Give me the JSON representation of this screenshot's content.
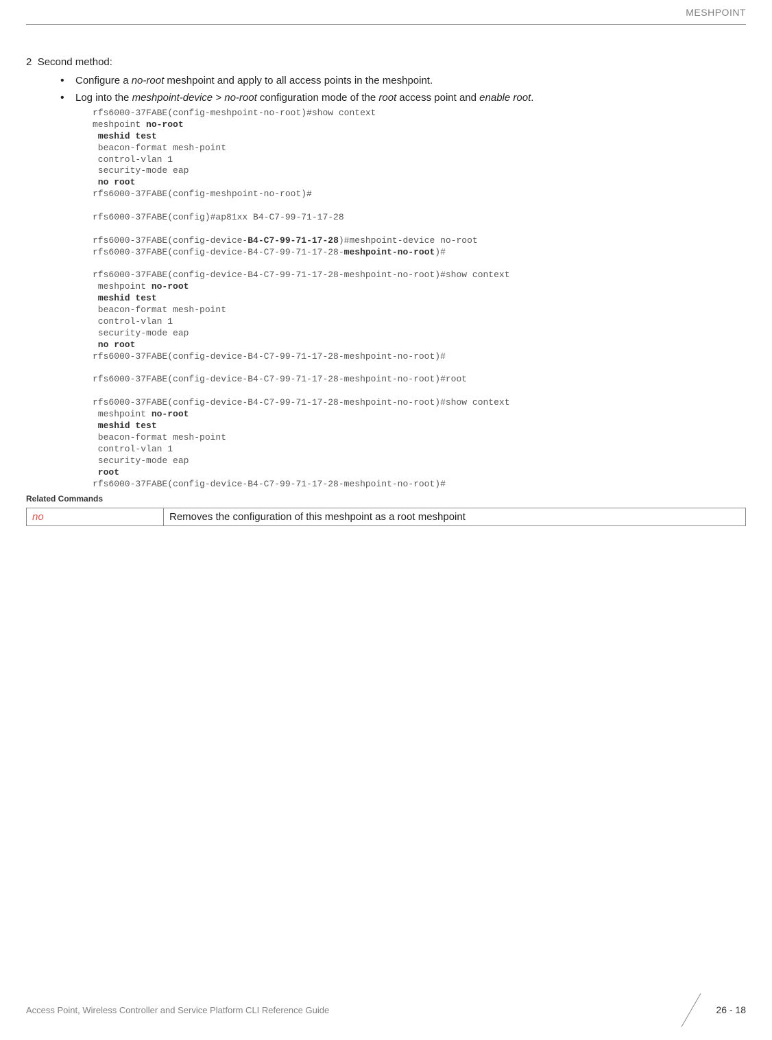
{
  "header": "MESHPOINT",
  "method": {
    "number": "2",
    "title": "Second method:",
    "bullets": [
      "Configure a <span class=\"italic\">no-root</span> meshpoint and apply to all access points in the meshpoint.",
      "Log into the <span class=\"italic\">meshpoint-device &gt; no-root</span> configuration mode of the <span class=\"italic\">root</span> access point and <span class=\"italic\">enable root</span>."
    ]
  },
  "code": {
    "l1": "rfs6000-37FABE(config-meshpoint-no-root)#show context",
    "l2a": "meshpoint ",
    "l2b": "no-root",
    "l3": " meshid test",
    "l4": " beacon-format mesh-point",
    "l5": " control-vlan 1",
    "l6": " security-mode eap",
    "l7": " no root",
    "l8": "rfs6000-37FABE(config-meshpoint-no-root)#",
    "l9": "",
    "l10": "rfs6000-37FABE(config)#ap81xx B4-C7-99-71-17-28",
    "l11": "",
    "l12a": "rfs6000-37FABE(config-device-",
    "l12b": "B4-C7-99-71-17-28",
    "l12c": ")#meshpoint-device no-root",
    "l13a": "rfs6000-37FABE(config-device-B4-C7-99-71-17-28-",
    "l13b": "meshpoint-no-root",
    "l13c": ")#",
    "l14": "",
    "l15": "rfs6000-37FABE(config-device-B4-C7-99-71-17-28-meshpoint-no-root)#show context",
    "l16a": " meshpoint ",
    "l16b": "no-root",
    "l17": " meshid test",
    "l18": " beacon-format mesh-point",
    "l19": " control-vlan 1",
    "l20": " security-mode eap",
    "l21": " no root",
    "l22": "rfs6000-37FABE(config-device-B4-C7-99-71-17-28-meshpoint-no-root)#",
    "l23": "",
    "l24": "rfs6000-37FABE(config-device-B4-C7-99-71-17-28-meshpoint-no-root)#root",
    "l25": "",
    "l26": "rfs6000-37FABE(config-device-B4-C7-99-71-17-28-meshpoint-no-root)#show context",
    "l27a": " meshpoint ",
    "l27b": "no-root",
    "l28": " meshid test",
    "l29": " beacon-format mesh-point",
    "l30": " control-vlan 1",
    "l31": " security-mode eap",
    "l32": " root",
    "l33": "rfs6000-37FABE(config-device-B4-C7-99-71-17-28-meshpoint-no-root)#"
  },
  "relatedCommands": {
    "title": "Related Commands",
    "rows": [
      {
        "cmd": "no",
        "desc": "Removes the configuration of this meshpoint as a root meshpoint"
      }
    ]
  },
  "footer": {
    "text": "Access Point, Wireless Controller and Service Platform CLI Reference Guide",
    "page": "26 - 18"
  }
}
